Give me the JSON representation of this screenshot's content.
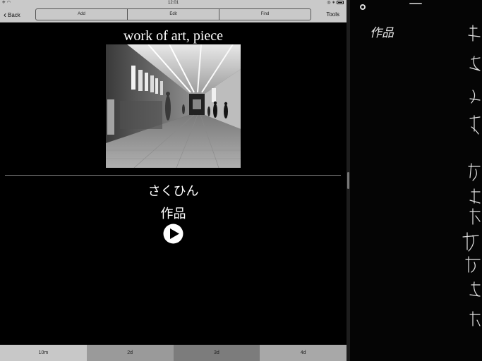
{
  "status_bar": {
    "time": "12:01"
  },
  "nav": {
    "back_label": "Back",
    "segments": [
      "Add",
      "Edit",
      "Find"
    ],
    "tools_label": "Tools"
  },
  "card": {
    "title": "work of art, piece",
    "reading": "さくひん",
    "kanji": "作品"
  },
  "bottom_tabs": [
    {
      "label": "10m",
      "color": "#c8c8c8"
    },
    {
      "label": "2d",
      "color": "#9a9a9a"
    },
    {
      "label": "3d",
      "color": "#7c7c7c"
    },
    {
      "label": "4d",
      "color": "#a8a8a8"
    }
  ],
  "handwriting_pane": {
    "note": "作品"
  }
}
